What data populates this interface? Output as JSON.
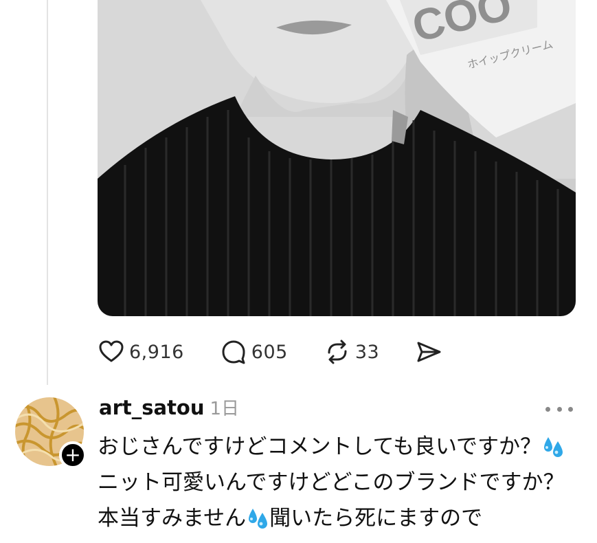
{
  "post": {
    "photo_text": {
      "brand": "COO",
      "product": "ホイップクリーム"
    },
    "actions": [
      {
        "icon": "heart-icon",
        "count": "6,916"
      },
      {
        "icon": "comment-icon",
        "count": "605"
      },
      {
        "icon": "repost-icon",
        "count": "33"
      },
      {
        "icon": "share-icon",
        "count": ""
      }
    ]
  },
  "reply": {
    "username": "art_satou",
    "time": "1日",
    "lines": [
      "おじさんですけどコメントしても良いですか？",
      "ニット可愛いんですけどどこのブランドですか？",
      "本当すみません",
      "聞いたら死にますので"
    ],
    "emoji": "sweat-droplets-icon"
  },
  "colors": {
    "accent_emoji": "#2fa8e8",
    "text": "#111111",
    "muted": "#999999"
  }
}
